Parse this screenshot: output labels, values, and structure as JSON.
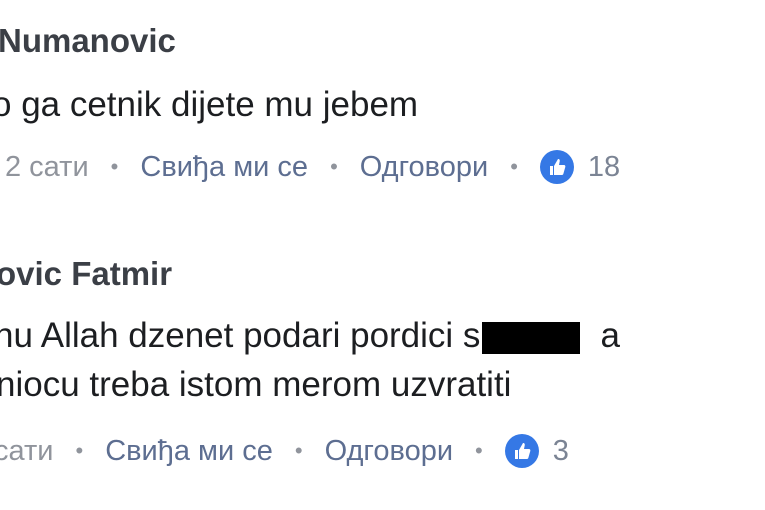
{
  "comments": [
    {
      "author": "Numanovic",
      "lines": [
        "o ga cetnik dijete mu jebem"
      ],
      "time": "2 сати",
      "like_label": "Свиђа ми се",
      "reply_label": "Одговори",
      "reaction_icon": "thumbs-up-icon",
      "reaction_count": "18"
    },
    {
      "author": "ovic Fatmir",
      "lines": [
        "nu Allah dzenet podari pordici s",
        "niocu treba istom merom uzvratiti"
      ],
      "line_tail": "a",
      "time": "сати",
      "like_label": "Свиђа ми се",
      "reply_label": "Одговори",
      "reaction_icon": "thumbs-up-icon",
      "reaction_count": "3"
    }
  ],
  "colors": {
    "like_badge": "#3578e5",
    "author": "#3b3f46",
    "text": "#1c1e21",
    "meta": "#7b8494"
  }
}
